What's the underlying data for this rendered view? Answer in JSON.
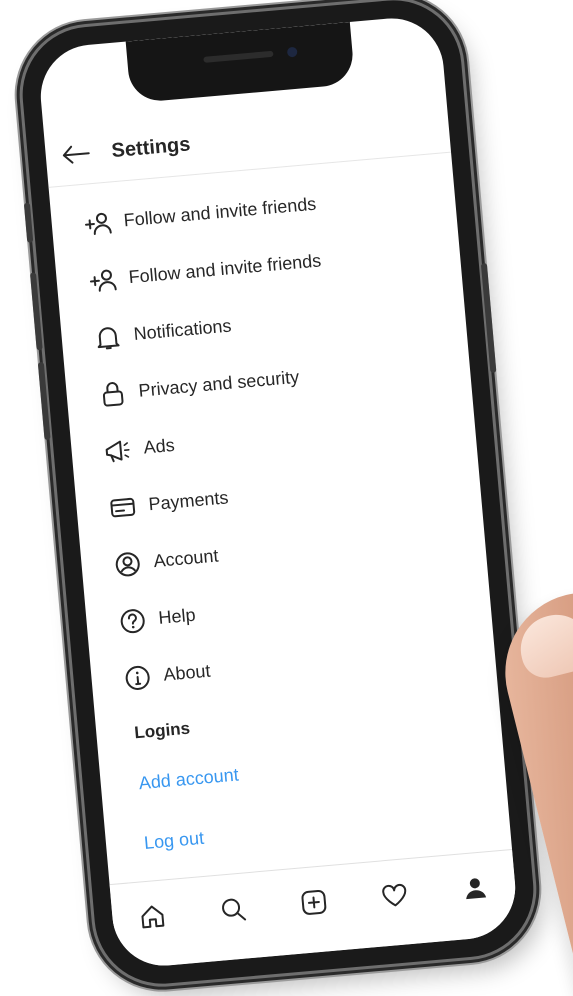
{
  "header": {
    "title": "Settings"
  },
  "menu": [
    {
      "label": "Follow and invite friends",
      "icon": "add-person-icon"
    },
    {
      "label": "Follow and invite friends",
      "icon": "add-person-icon"
    },
    {
      "label": "Notifications",
      "icon": "bell-icon"
    },
    {
      "label": "Privacy and security",
      "icon": "lock-icon"
    },
    {
      "label": "Ads",
      "icon": "megaphone-icon"
    },
    {
      "label": "Payments",
      "icon": "card-icon"
    },
    {
      "label": "Account",
      "icon": "account-circle-icon"
    },
    {
      "label": "Help",
      "icon": "help-circle-icon"
    },
    {
      "label": "About",
      "icon": "info-circle-icon"
    }
  ],
  "logins": {
    "heading": "Logins",
    "add_account": "Add account",
    "log_out": "Log out"
  },
  "tabbar": [
    "home-icon",
    "search-icon",
    "new-post-icon",
    "heart-icon",
    "profile-icon"
  ],
  "colors": {
    "link": "#3897f0",
    "text": "#262626"
  }
}
